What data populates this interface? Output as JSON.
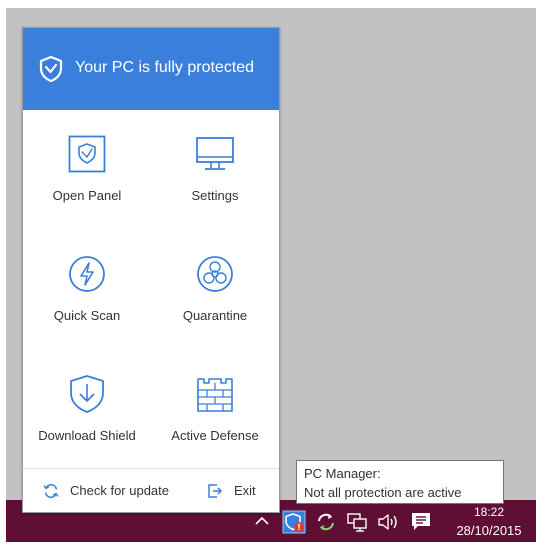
{
  "panel": {
    "header_title": "Your PC is fully protected",
    "tiles": [
      {
        "label": "Open Panel",
        "icon": "open-panel-icon"
      },
      {
        "label": "Settings",
        "icon": "monitor-icon"
      },
      {
        "label": "Quick Scan",
        "icon": "lightning-icon"
      },
      {
        "label": "Quarantine",
        "icon": "biohazard-icon"
      },
      {
        "label": "Download Shield",
        "icon": "download-shield-icon"
      },
      {
        "label": "Active Defense",
        "icon": "firewall-icon"
      }
    ],
    "footer": {
      "update_label": "Check for update",
      "exit_label": "Exit"
    }
  },
  "tooltip": {
    "title": "PC Manager:",
    "message": "Not all protection are active"
  },
  "taskbar": {
    "time": "18:22",
    "date": "28/10/2015"
  },
  "colors": {
    "accent": "#3a7fdc",
    "taskbar": "#5e0f33",
    "desktop": "#c2c2c2",
    "alert": "#e03a2f"
  }
}
